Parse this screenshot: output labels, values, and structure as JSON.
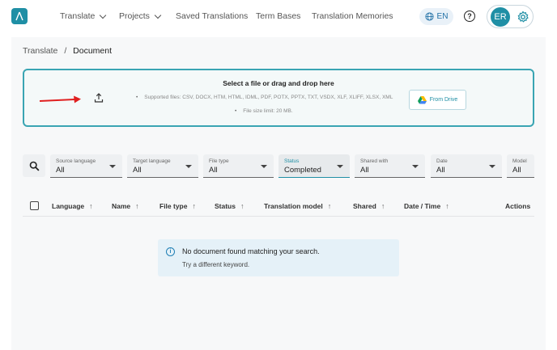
{
  "nav": {
    "items": [
      {
        "label": "Translate",
        "has_dropdown": true
      },
      {
        "label": "Projects",
        "has_dropdown": true
      },
      {
        "label": "Saved Translations",
        "has_dropdown": false
      },
      {
        "label": "Term Bases",
        "has_dropdown": false
      },
      {
        "label": "Translation Memories",
        "has_dropdown": false
      }
    ],
    "language": "EN",
    "help_glyph": "?",
    "avatar_initials": "ER",
    "accent_color": "#1f8fa5"
  },
  "breadcrumb": {
    "root": "Translate",
    "separator": "/",
    "current": "Document"
  },
  "upload": {
    "title": "Select a file or drag and drop here",
    "supported_files": "Supported files: CSV, DOCX, HTM, HTML, IDML, PDF, POTX, PPTX, TXT, VSDX, XLF, XLIFF, XLSX, XML",
    "size_limit": "File size limit: 20 MB.",
    "drive_button": "From Drive"
  },
  "filters": [
    {
      "label": "Source language",
      "value": "All",
      "active": false
    },
    {
      "label": "Target language",
      "value": "All",
      "active": false
    },
    {
      "label": "File type",
      "value": "All",
      "active": false
    },
    {
      "label": "Status",
      "value": "Completed",
      "active": true
    },
    {
      "label": "Shared with",
      "value": "All",
      "active": false
    },
    {
      "label": "Date",
      "value": "All",
      "active": false
    },
    {
      "label": "Model",
      "value": "All",
      "active": false
    }
  ],
  "table": {
    "columns": [
      {
        "label": "Language",
        "sortable": true
      },
      {
        "label": "Name",
        "sortable": true
      },
      {
        "label": "File type",
        "sortable": true
      },
      {
        "label": "Status",
        "sortable": true
      },
      {
        "label": "Translation model",
        "sortable": true
      },
      {
        "label": "Shared",
        "sortable": true
      },
      {
        "label": "Date / Time",
        "sortable": true
      },
      {
        "label": "Actions",
        "sortable": false
      }
    ],
    "sort_glyph": "↑"
  },
  "empty_state": {
    "title": "No document found matching your search.",
    "subtitle": "Try a different keyword.",
    "info_glyph": "i"
  }
}
